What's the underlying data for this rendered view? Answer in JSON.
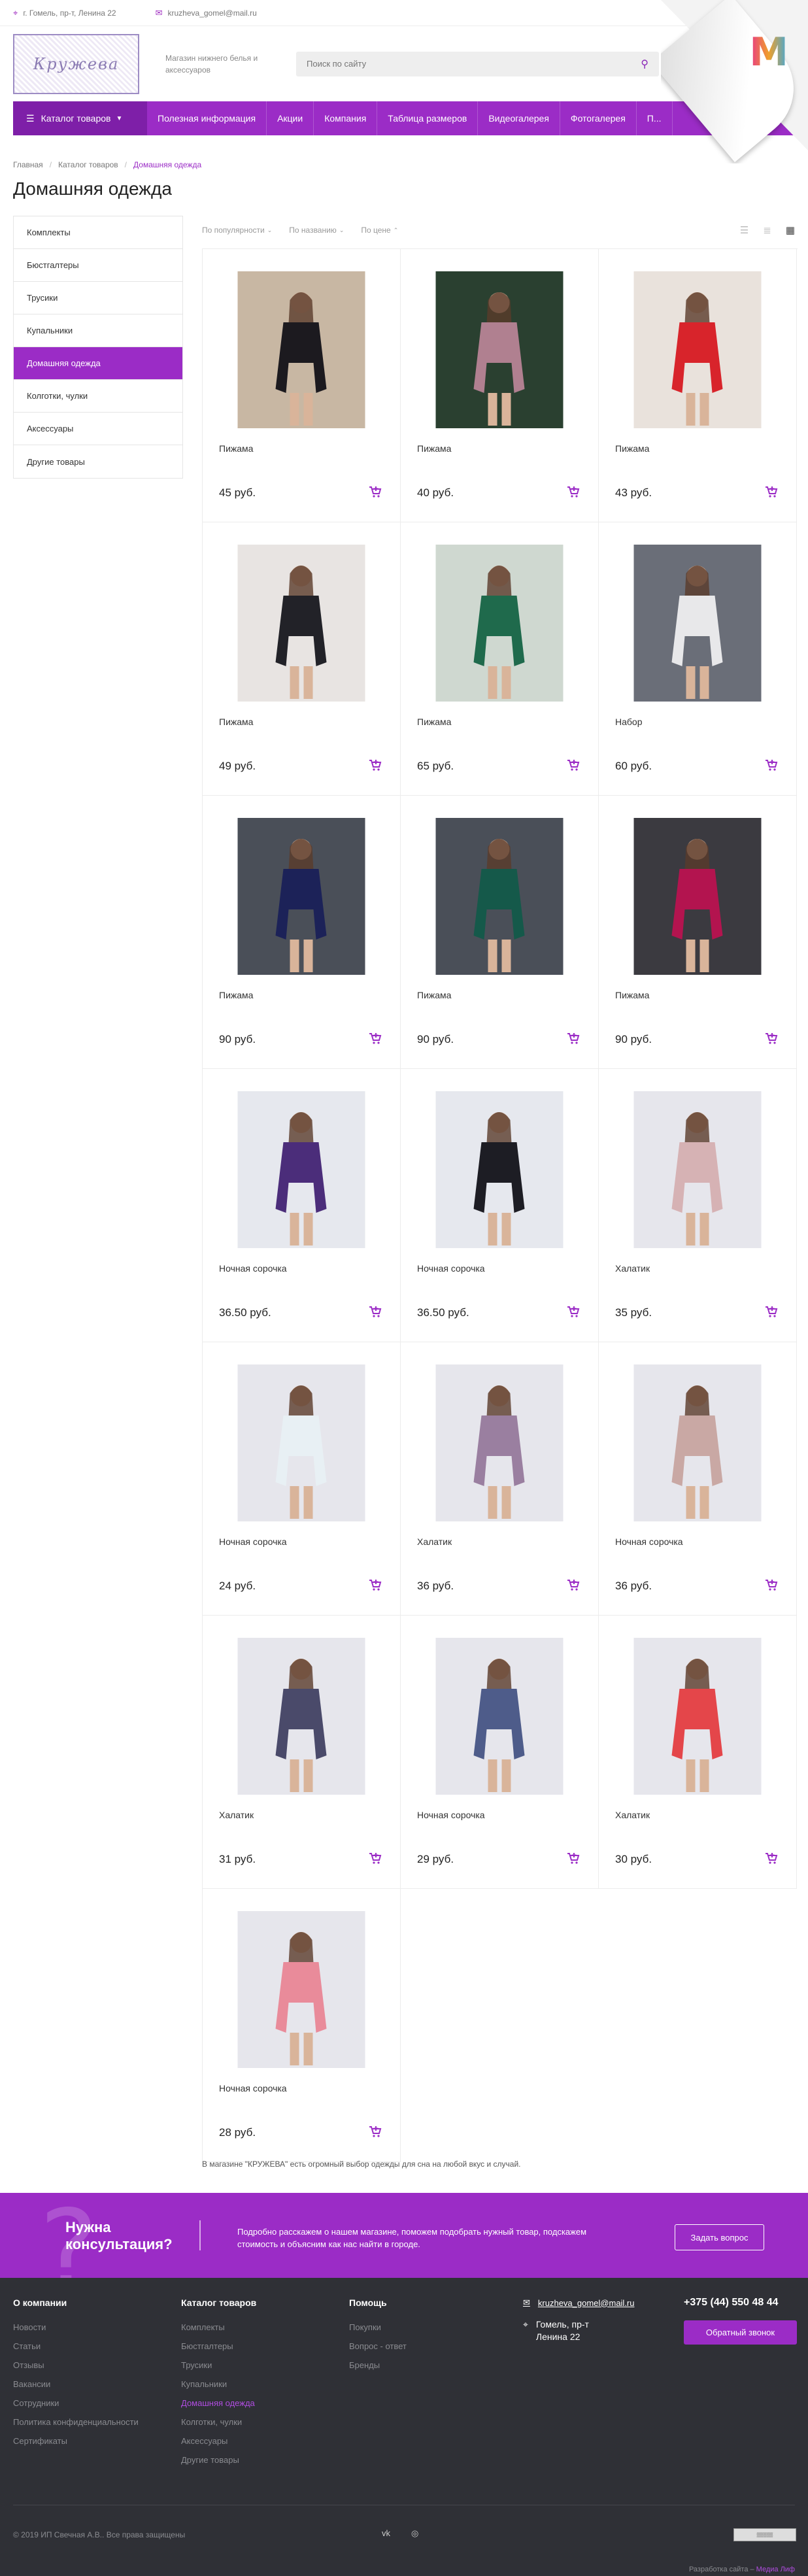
{
  "topbar": {
    "address": "г. Гомель, пр-т, Ленина 22",
    "email": "kruzheva_gomel@mail.ru"
  },
  "header": {
    "logo_text": "Кружева",
    "slogan": "Магазин нижнего белья и аксессуаров",
    "search_placeholder": "Поиск по сайту"
  },
  "nav": {
    "catalog": "Каталог товаров",
    "links": [
      "Полезная информация",
      "Акции",
      "Компания",
      "Таблица размеров",
      "Видеогалерея",
      "Фотогалерея",
      "П..."
    ]
  },
  "breadcrumbs": [
    "Главная",
    "Каталог товаров",
    "Домашняя одежда"
  ],
  "page_title": "Домашняя одежда",
  "sidebar": {
    "items": [
      "Комплекты",
      "Бюстгалтеры",
      "Трусики",
      "Купальники",
      "Домашняя одежда",
      "Колготки, чулки",
      "Аксессуары",
      "Другие товары"
    ],
    "active_index": 4
  },
  "sort": {
    "options": [
      "По популярности",
      "По названию",
      "По цене"
    ]
  },
  "products": [
    {
      "name": "Пижама",
      "price": "45 руб.",
      "colors": [
        "#c8b7a3",
        "#1c1a1f"
      ]
    },
    {
      "name": "Пижама",
      "price": "40 руб.",
      "colors": [
        "#2a4030",
        "#b08090"
      ]
    },
    {
      "name": "Пижама",
      "price": "43 руб.",
      "colors": [
        "#e9e2dc",
        "#d8242b"
      ]
    },
    {
      "name": "Пижама",
      "price": "49 руб.",
      "colors": [
        "#e8e4e2",
        "#222228"
      ]
    },
    {
      "name": "Пижама",
      "price": "65 руб.",
      "colors": [
        "#cfd8d0",
        "#1f6a4c"
      ]
    },
    {
      "name": "Набор",
      "price": "60 руб.",
      "colors": [
        "#6a6e78",
        "#e8e8ea"
      ]
    },
    {
      "name": "Пижама",
      "price": "90 руб.",
      "colors": [
        "#4a4f58",
        "#1c2258"
      ]
    },
    {
      "name": "Пижама",
      "price": "90 руб.",
      "colors": [
        "#4a4f58",
        "#15594a"
      ]
    },
    {
      "name": "Пижама",
      "price": "90 руб.",
      "colors": [
        "#3b3a40",
        "#b3144f"
      ]
    },
    {
      "name": "Ночная сорочка",
      "price": "36.50 руб.",
      "colors": [
        "#e6e8ee",
        "#4b2d7a"
      ]
    },
    {
      "name": "Ночная сорочка",
      "price": "36.50 руб.",
      "colors": [
        "#e6e8ee",
        "#1d1d24"
      ]
    },
    {
      "name": "Халатик",
      "price": "35 руб.",
      "colors": [
        "#e6e6ec",
        "#d6b2b4"
      ]
    },
    {
      "name": "Ночная сорочка",
      "price": "24 руб.",
      "colors": [
        "#e6e6ec",
        "#e8f0f4"
      ]
    },
    {
      "name": "Халатик",
      "price": "36 руб.",
      "colors": [
        "#e6e6ec",
        "#9a7fa0"
      ]
    },
    {
      "name": "Ночная сорочка",
      "price": "36 руб.",
      "colors": [
        "#e6e6ec",
        "#c9a8a4"
      ]
    },
    {
      "name": "Халатик",
      "price": "31 руб.",
      "colors": [
        "#e6e6ec",
        "#4a4a6a"
      ]
    },
    {
      "name": "Ночная сорочка",
      "price": "29 руб.",
      "colors": [
        "#e6e6ec",
        "#4e5c8a"
      ]
    },
    {
      "name": "Халатик",
      "price": "30 руб.",
      "colors": [
        "#e6e6ec",
        "#e4464a"
      ]
    },
    {
      "name": "Ночная сорочка",
      "price": "28 руб.",
      "colors": [
        "#e6e6ec",
        "#e98b9a"
      ]
    }
  ],
  "description": "В магазине \"КРУЖЕВА\" есть огромный выбор одежды для сна на любой вкус и случай.",
  "consult": {
    "title": "Нужна консультация?",
    "text": "Подробно расскажем о нашем магазине, поможем подобрать нужный товар, подскажем стоимость и объясним как нас найти в городе.",
    "button": "Задать вопрос"
  },
  "footer": {
    "col1": {
      "title": "О компании",
      "links": [
        "Новости",
        "Статьи",
        "Отзывы",
        "Вакансии",
        "Сотрудники",
        "Политика конфиденциальности",
        "Сертификаты"
      ]
    },
    "col2": {
      "title": "Каталог товаров",
      "links": [
        "Комплекты",
        "Бюстгалтеры",
        "Трусики",
        "Купальники",
        "Домашняя одежда",
        "Колготки, чулки",
        "Аксессуары",
        "Другие товары"
      ],
      "active_index": 4
    },
    "col3": {
      "title": "Помощь",
      "links": [
        "Покупки",
        "Вопрос - ответ",
        "Бренды"
      ]
    },
    "email": "kruzheva_gomel@mail.ru",
    "address": "Гомель, пр-т Ленина 22",
    "phone": "+375 (44) 550 48 44",
    "callback": "Обратный звонок",
    "copyright": "© 2019 ИП Свечная А.В.. Все права защищены",
    "social": [
      "vk",
      "instagram"
    ],
    "developer_label": "Разработка сайта –",
    "developer_name": "Медиа Лиф"
  },
  "accent_color": "#9b2cc6"
}
